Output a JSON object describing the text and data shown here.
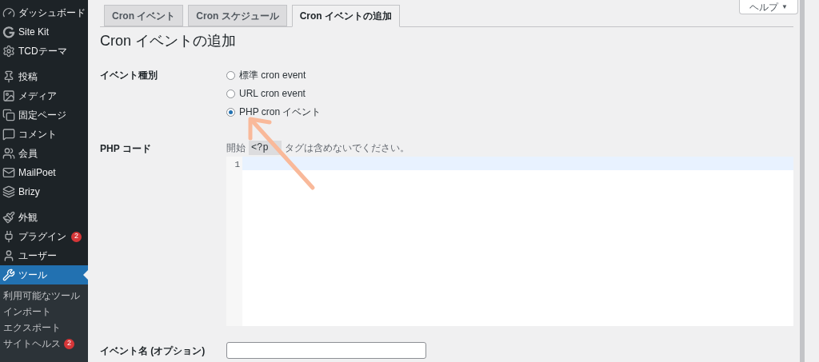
{
  "sidebar": {
    "groups": [
      [
        {
          "label": "ダッシュボード",
          "selected": false
        },
        {
          "label": "Site Kit",
          "selected": false
        },
        {
          "label": "TCDテーマ",
          "selected": false
        }
      ],
      [
        {
          "label": "投稿",
          "selected": false
        },
        {
          "label": "メディア",
          "selected": false
        },
        {
          "label": "固定ページ",
          "selected": false
        },
        {
          "label": "コメント",
          "selected": false
        },
        {
          "label": "会員",
          "selected": false
        },
        {
          "label": "MailPoet",
          "selected": false
        },
        {
          "label": "Brizy",
          "selected": false
        }
      ],
      [
        {
          "label": "外観",
          "selected": false
        },
        {
          "label": "プラグイン",
          "badge": "2",
          "selected": false
        },
        {
          "label": "ユーザー",
          "selected": false
        },
        {
          "label": "ツール",
          "selected": true
        }
      ]
    ],
    "submenu": [
      {
        "label": "利用可能なツール"
      },
      {
        "label": "インポート"
      },
      {
        "label": "エクスポート"
      },
      {
        "label": "サイトヘルス",
        "badge": "2"
      }
    ]
  },
  "help_button": {
    "label": "ヘルプ",
    "caret": "▼"
  },
  "tabs": [
    {
      "label": "Cron イベント",
      "selected": false
    },
    {
      "label": "Cron スケジュール",
      "selected": false
    },
    {
      "label": "Cron イベントの追加",
      "selected": true
    }
  ],
  "page_title": "Cron イベントの追加",
  "event_type": {
    "label": "イベント種別",
    "options": [
      {
        "label": "標準 cron event",
        "selected": false
      },
      {
        "label": "URL cron event",
        "selected": false
      },
      {
        "label": "PHP cron イベント",
        "selected": true
      }
    ]
  },
  "php_code": {
    "label": "PHP コード",
    "hint_before": "開始",
    "hint_code": "<?p",
    "hint_after": "タグは含めないでください。",
    "line_number": "1"
  },
  "event_name": {
    "label": "イベント名 (オプション)"
  }
}
